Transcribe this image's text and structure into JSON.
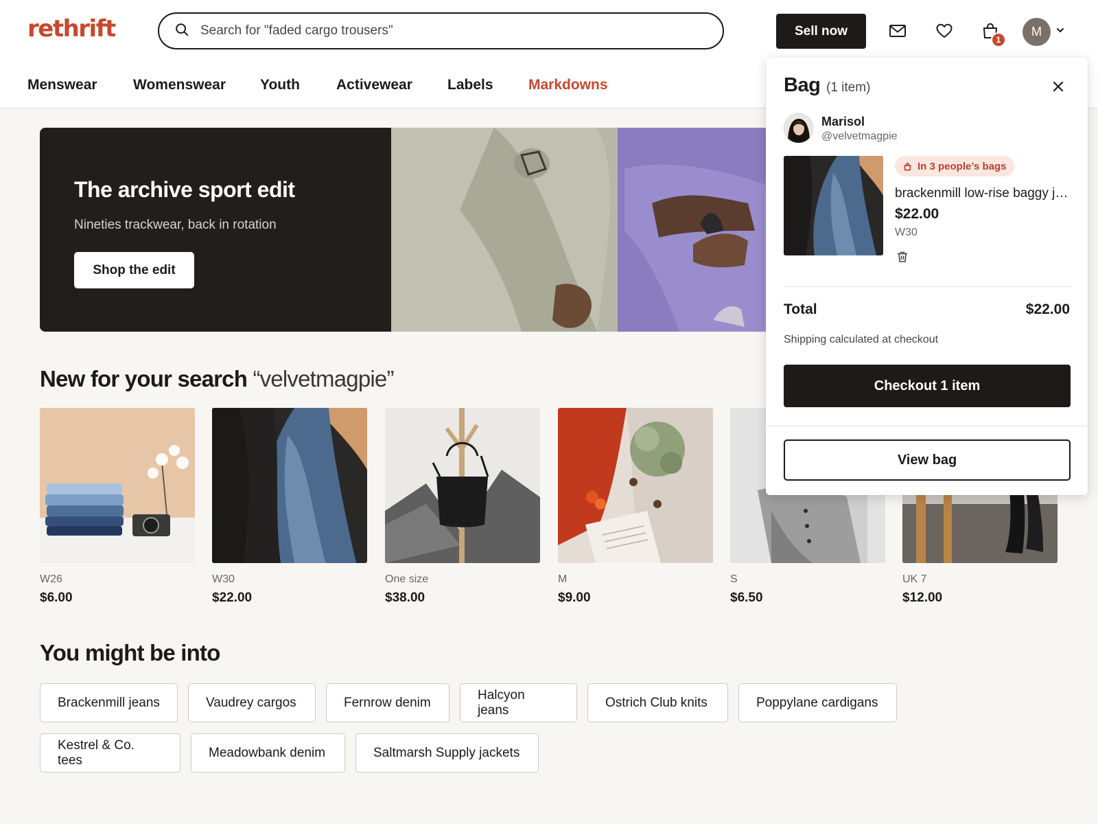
{
  "brand": {
    "logo_text": "rethrift",
    "accent": "#c6482f"
  },
  "search": {
    "placeholder": "Search for \"faded cargo trousers\"",
    "icon": "search-icon"
  },
  "header": {
    "sell_label": "Sell now",
    "messages_icon": "mail-icon",
    "favourites_icon": "heart-icon",
    "bag_icon": "shopping-bag-icon",
    "bag_count": "1",
    "avatar_initial": "M"
  },
  "nav": {
    "items": [
      "Menswear",
      "Womenswear",
      "Youth",
      "Activewear",
      "Labels",
      "Markdowns"
    ]
  },
  "hero": {
    "title": "The archive sport edit",
    "subtitle": "Nineties trackwear, back in rotation",
    "cta": "Shop the edit",
    "slide_count": 3,
    "active_slide": 1
  },
  "new_section": {
    "title": "New for your search",
    "query": "“velvetmagpie”"
  },
  "products": [
    {
      "size": "W26",
      "price": "$6.00"
    },
    {
      "size": "W30",
      "price": "$22.00"
    },
    {
      "size": "One size",
      "price": "$38.00"
    },
    {
      "size": "M",
      "price": "$9.00"
    },
    {
      "size": "S",
      "price": "$6.50"
    },
    {
      "size": "UK 7",
      "price": "$12.00"
    }
  ],
  "into_section": {
    "title": "You might be into"
  },
  "chips": [
    "Brackenmill jeans",
    "Vaudrey cargos",
    "Fernrow denim",
    "Halcyon jeans",
    "Ostrich Club knits",
    "Poppylane cardigans",
    "Kestrel & Co. tees",
    "Meadowbank denim",
    "Saltmarsh Supply jackets"
  ],
  "bag": {
    "title": "Bag",
    "count": "(1 item)",
    "seller": {
      "name": "Marisol",
      "handle": "@velvetmagpie"
    },
    "item": {
      "demand_badge": "In 3 people’s bags",
      "title": "brackenmill low-rise baggy jeans",
      "price": "$22.00",
      "size": "W30"
    },
    "total_label": "Total",
    "total_value": "$22.00",
    "shipping_note": "Shipping calculated at checkout",
    "checkout_label": "Checkout 1 item",
    "view_bag_label": "View bag"
  }
}
